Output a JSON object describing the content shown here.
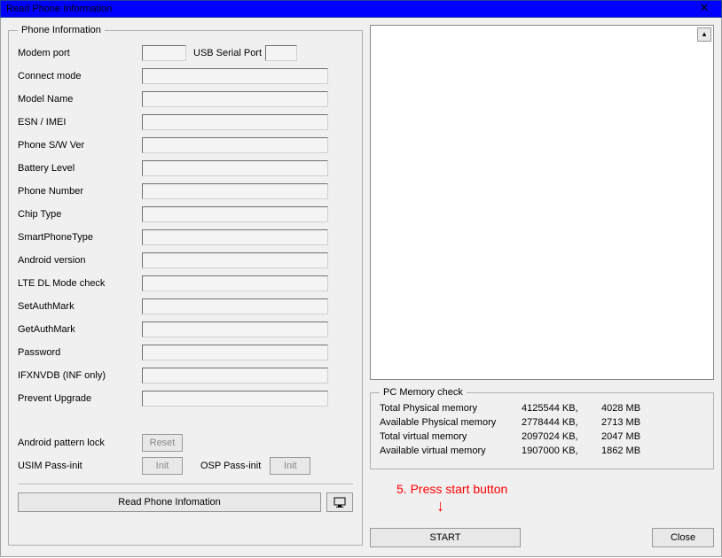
{
  "window": {
    "title": "Read Phone Information",
    "close_glyph": "✕"
  },
  "phone_info": {
    "legend": "Phone Information",
    "modem_port_label": "Modem port",
    "usb_serial_label": "USB Serial Port",
    "fields": [
      "Connect mode",
      "Model Name",
      "ESN / IMEI",
      "Phone S/W Ver",
      "Battery Level",
      "Phone Number",
      "Chip Type",
      "SmartPhoneType",
      "Android version",
      "LTE DL Mode check",
      "SetAuthMark",
      "GetAuthMark",
      "Password",
      "IFXNVDB (INF only)",
      "Prevent Upgrade"
    ],
    "android_pattern_lock": "Android pattern lock",
    "reset_label": "Reset",
    "usim_pass_init": "USIM Pass-init",
    "init_label": "Init",
    "osp_pass_init": "OSP Pass-init",
    "read_button": "Read Phone Infomation"
  },
  "memory": {
    "legend": "PC Memory check",
    "rows": [
      {
        "label": "Total Physical memory",
        "kb": "4125544 KB,",
        "mb": "4028 MB"
      },
      {
        "label": "Available Physical memory",
        "kb": "2778444 KB,",
        "mb": "2713 MB"
      },
      {
        "label": "Total virtual memory",
        "kb": "2097024 KB,",
        "mb": "2047 MB"
      },
      {
        "label": "Available virtual memory",
        "kb": "1907000 KB,",
        "mb": "1862 MB"
      }
    ]
  },
  "annotation": {
    "text": "5. Press start button",
    "arrow": "↓"
  },
  "buttons": {
    "start": "START",
    "close": "Close"
  },
  "scroll": {
    "up": "▴"
  }
}
